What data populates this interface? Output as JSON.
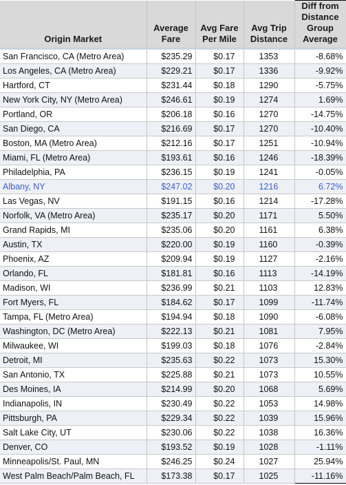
{
  "table": {
    "headers": [
      "Origin Market",
      "Average Fare",
      "Avg Fare Per Mile",
      "Avg Trip Distance",
      "Diff from Distance Group Average"
    ],
    "highlight_color": "#3a5fc8",
    "rows": [
      {
        "market": "San Francisco, CA (Metro Area)",
        "fare": "$235.29",
        "per_mile": "$0.17",
        "distance": "1353",
        "diff": "-8.68%"
      },
      {
        "market": "Los Angeles, CA (Metro Area)",
        "fare": "$229.21",
        "per_mile": "$0.17",
        "distance": "1336",
        "diff": "-9.92%"
      },
      {
        "market": "Hartford, CT",
        "fare": "$231.44",
        "per_mile": "$0.18",
        "distance": "1290",
        "diff": "-5.75%"
      },
      {
        "market": "New York City, NY (Metro Area)",
        "fare": "$246.61",
        "per_mile": "$0.19",
        "distance": "1274",
        "diff": "1.69%"
      },
      {
        "market": "Portland, OR",
        "fare": "$206.18",
        "per_mile": "$0.16",
        "distance": "1270",
        "diff": "-14.75%"
      },
      {
        "market": "San Diego, CA",
        "fare": "$216.69",
        "per_mile": "$0.17",
        "distance": "1270",
        "diff": "-10.40%"
      },
      {
        "market": "Boston, MA (Metro Area)",
        "fare": "$212.16",
        "per_mile": "$0.17",
        "distance": "1251",
        "diff": "-10.94%"
      },
      {
        "market": "Miami, FL (Metro Area)",
        "fare": "$193.61",
        "per_mile": "$0.16",
        "distance": "1246",
        "diff": "-18.39%"
      },
      {
        "market": "Philadelphia, PA",
        "fare": "$236.15",
        "per_mile": "$0.19",
        "distance": "1241",
        "diff": "-0.05%"
      },
      {
        "market": "Albany, NY",
        "fare": "$247.02",
        "per_mile": "$0.20",
        "distance": "1216",
        "diff": "6.72%",
        "highlighted": true
      },
      {
        "market": "Las Vegas, NV",
        "fare": "$191.15",
        "per_mile": "$0.16",
        "distance": "1214",
        "diff": "-17.28%"
      },
      {
        "market": "Norfolk, VA (Metro Area)",
        "fare": "$235.17",
        "per_mile": "$0.20",
        "distance": "1171",
        "diff": "5.50%"
      },
      {
        "market": "Grand Rapids, MI",
        "fare": "$235.06",
        "per_mile": "$0.20",
        "distance": "1161",
        "diff": "6.38%"
      },
      {
        "market": "Austin, TX",
        "fare": "$220.00",
        "per_mile": "$0.19",
        "distance": "1160",
        "diff": "-0.39%"
      },
      {
        "market": "Phoenix, AZ",
        "fare": "$209.94",
        "per_mile": "$0.19",
        "distance": "1127",
        "diff": "-2.16%"
      },
      {
        "market": "Orlando, FL",
        "fare": "$181.81",
        "per_mile": "$0.16",
        "distance": "1113",
        "diff": "-14.19%"
      },
      {
        "market": "Madison, WI",
        "fare": "$236.99",
        "per_mile": "$0.21",
        "distance": "1103",
        "diff": "12.83%"
      },
      {
        "market": "Fort Myers, FL",
        "fare": "$184.62",
        "per_mile": "$0.17",
        "distance": "1099",
        "diff": "-11.74%"
      },
      {
        "market": "Tampa, FL (Metro Area)",
        "fare": "$194.94",
        "per_mile": "$0.18",
        "distance": "1090",
        "diff": "-6.08%"
      },
      {
        "market": "Washington, DC (Metro Area)",
        "fare": "$222.13",
        "per_mile": "$0.21",
        "distance": "1081",
        "diff": "7.95%"
      },
      {
        "market": "Milwaukee, WI",
        "fare": "$199.03",
        "per_mile": "$0.18",
        "distance": "1076",
        "diff": "-2.84%"
      },
      {
        "market": "Detroit, MI",
        "fare": "$235.63",
        "per_mile": "$0.22",
        "distance": "1073",
        "diff": "15.30%"
      },
      {
        "market": "San Antonio, TX",
        "fare": "$225.88",
        "per_mile": "$0.21",
        "distance": "1073",
        "diff": "10.55%"
      },
      {
        "market": "Des Moines, IA",
        "fare": "$214.99",
        "per_mile": "$0.20",
        "distance": "1068",
        "diff": "5.69%"
      },
      {
        "market": "Indianapolis, IN",
        "fare": "$230.49",
        "per_mile": "$0.22",
        "distance": "1053",
        "diff": "14.98%"
      },
      {
        "market": "Pittsburgh, PA",
        "fare": "$229.34",
        "per_mile": "$0.22",
        "distance": "1039",
        "diff": "15.96%"
      },
      {
        "market": "Salt Lake City, UT",
        "fare": "$230.06",
        "per_mile": "$0.22",
        "distance": "1038",
        "diff": "16.36%"
      },
      {
        "market": "Denver, CO",
        "fare": "$193.52",
        "per_mile": "$0.19",
        "distance": "1028",
        "diff": "-1.11%"
      },
      {
        "market": "Minneapolis/St. Paul, MN",
        "fare": "$246.25",
        "per_mile": "$0.24",
        "distance": "1027",
        "diff": "25.94%"
      },
      {
        "market": "West Palm Beach/Palm Beach, FL",
        "fare": "$173.38",
        "per_mile": "$0.17",
        "distance": "1025",
        "diff": "-11.16%"
      }
    ]
  }
}
